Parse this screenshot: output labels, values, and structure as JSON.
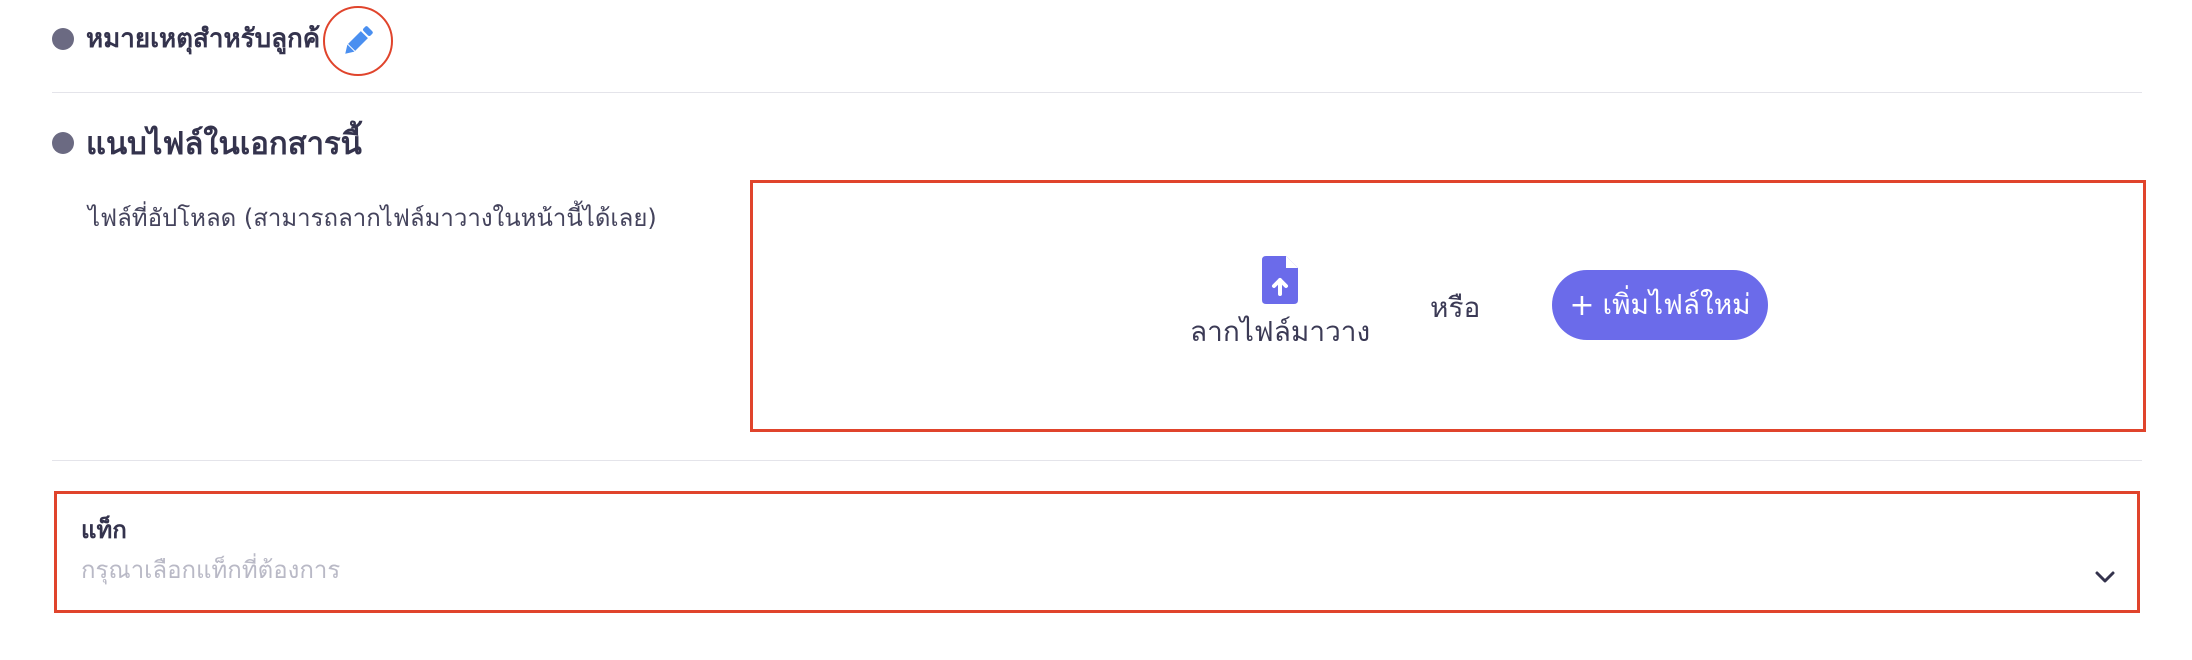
{
  "notes_section": {
    "title": "หมายเหตุสำหรับลูกค้",
    "edit_icon": "pencil-icon"
  },
  "attach_section": {
    "title": "แนบไฟล์ในเอกสารนี้",
    "upload_label": "ไฟล์ที่อัปโหลด (สามารถลากไฟล์มาวางในหน้านี้ได้เลย)",
    "drop_icon": "file-upload-icon",
    "drop_text": "ลากไฟล์มาวาง",
    "or_text": "หรือ",
    "add_button": {
      "plus": "+",
      "label": "เพิ่มไฟล์ใหม่"
    }
  },
  "tags": {
    "label": "แท็ก",
    "placeholder": "กรุณาเลือกแท็กที่ต้องการ",
    "chevron_icon": "chevron-down-icon"
  },
  "colors": {
    "accent": "#6b6bea",
    "highlight": "#e0442c",
    "pencil": "#4a8ff0",
    "text": "#34334d",
    "placeholder": "#b9b9c6"
  }
}
